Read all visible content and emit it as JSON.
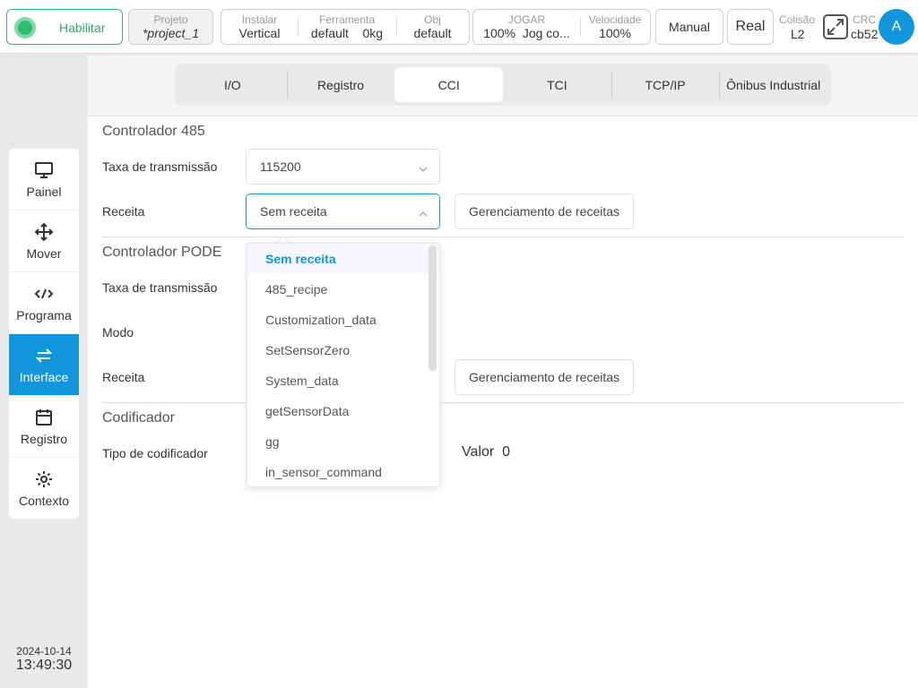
{
  "topbar": {
    "enable_label": "Habilitar",
    "project": {
      "caption": "Projeto",
      "value": "*project_1"
    },
    "install": {
      "caption": "Instalar",
      "value": "Vertical"
    },
    "tool": {
      "caption": "Ferramenta",
      "value": "default",
      "load": "0kg"
    },
    "obj": {
      "caption": "Obj",
      "value": "default"
    },
    "jog": {
      "caption": "JOGAR",
      "percent": "100%",
      "mode": "Jog co..."
    },
    "speed": {
      "caption": "Velocidade",
      "value": "100%"
    },
    "manual_label": "Manual",
    "real_label": "Real",
    "collision": {
      "caption": "Colisão",
      "value": "L2"
    },
    "crc": {
      "caption": "CRC",
      "value": "cb52"
    },
    "avatar": "A",
    "accent_color": "#1296db"
  },
  "sidebar": {
    "items": [
      {
        "label": "Painel",
        "icon": "monitor-icon"
      },
      {
        "label": "Mover",
        "icon": "move-arrows-icon"
      },
      {
        "label": "Programa",
        "icon": "code-icon"
      },
      {
        "label": "Interface",
        "icon": "swap-arrows-icon",
        "active": true
      },
      {
        "label": "Registro",
        "icon": "calendar-icon"
      },
      {
        "label": "Contexto",
        "icon": "gear-icon"
      }
    ],
    "date": "2024-10-14",
    "time": "13:49:30"
  },
  "tabs": [
    "I/O",
    "Registro",
    "CCI",
    "TCI",
    "TCP/IP",
    "Ônibus Industrial"
  ],
  "active_tab": "CCI",
  "controller485": {
    "title": "Controlador 485",
    "baud_label": "Taxa de transmissão",
    "baud_value": "115200",
    "recipe_label": "Receita",
    "recipe_value": "Sem receita",
    "manage_label": "Gerenciamento de receitas"
  },
  "can": {
    "title": "Controlador PODE",
    "baud_label": "Taxa de transmissão",
    "mode_label": "Modo",
    "recipe_label": "Receita",
    "manage_label": "Gerenciamento de receitas"
  },
  "encoder": {
    "title": "Codificador",
    "type_label": "Tipo de codificador",
    "value_label": "Valor",
    "value": "0"
  },
  "dropdown": {
    "options": [
      "Sem receita",
      "485_recipe",
      "Customization_data",
      "SetSensorZero",
      "System_data",
      "getSensorData",
      "gg",
      "in_sensor_command"
    ],
    "selected": "Sem receita"
  }
}
